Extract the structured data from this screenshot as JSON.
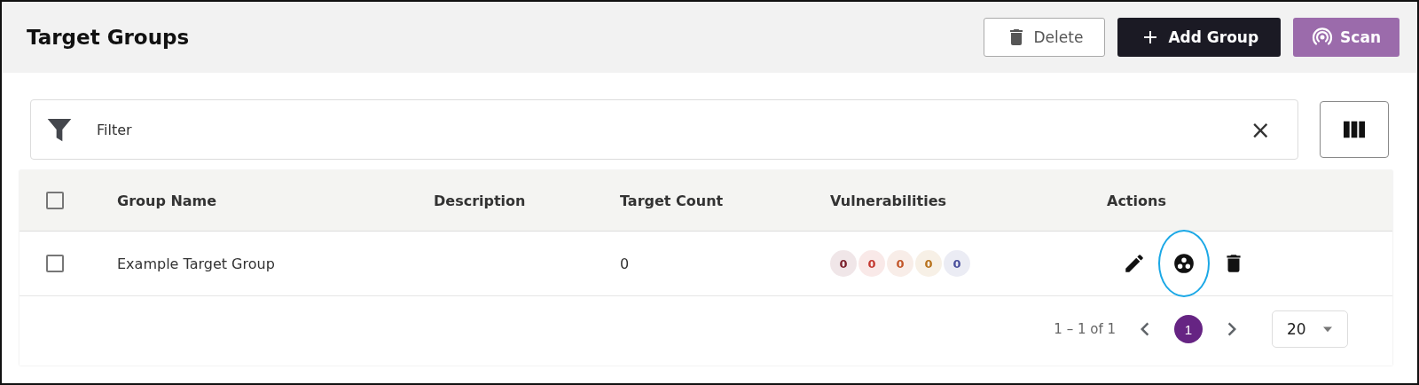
{
  "header": {
    "title": "Target Groups",
    "buttons": [
      {
        "label": "Delete",
        "kind": "delete"
      },
      {
        "label": "Add Group",
        "kind": "add"
      },
      {
        "label": "Scan",
        "kind": "scan"
      }
    ]
  },
  "filter": {
    "placeholder": "Filter",
    "clear": "×"
  },
  "table": {
    "select_all": {
      "checked": false
    },
    "columns": [
      "Group Name",
      "Description",
      "Target Count",
      "Vulnerabilities",
      "Actions"
    ],
    "rows": [
      {
        "checked": false,
        "group_name": "Example Target Group",
        "target_count": "0",
        "vulnerabilities": [
          {
            "value": "0",
            "color": "#7a1f2b"
          },
          {
            "value": "0",
            "color": "#c43a32"
          },
          {
            "value": "0",
            "color": "#c2572a"
          },
          {
            "value": "0",
            "color": "#b8731e"
          },
          {
            "value": "0",
            "color": "#4a4f9c"
          }
        ],
        "actions": [
          {
            "kind": "edit",
            "highlighted": false
          },
          {
            "kind": "groups",
            "highlighted": true
          },
          {
            "kind": "delete",
            "highlighted": false
          }
        ]
      }
    ]
  },
  "pagination": {
    "range": "1 – 1 of 1",
    "pages": [
      {
        "label": "1",
        "selected": true
      }
    ],
    "page_size": "20"
  }
}
